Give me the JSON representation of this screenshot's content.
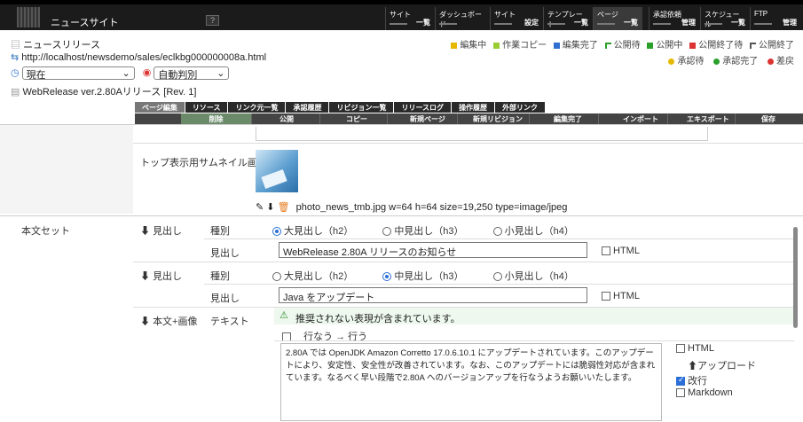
{
  "topbar": {
    "site_name": "ニュースサイト",
    "help": "?",
    "menus": [
      {
        "label": "サイト",
        "sub": "一覧"
      },
      {
        "label": "ダッシュボード",
        "sub": ""
      },
      {
        "label": "サイト",
        "sub": "設定"
      },
      {
        "label": "テンプレート",
        "sub": "一覧"
      },
      {
        "label": "ページ",
        "sub": "一覧"
      },
      {
        "label": "承認依頼",
        "sub": "管理"
      },
      {
        "label": "スケジュール",
        "sub": "一覧"
      },
      {
        "label": "FTP",
        "sub": "管理"
      }
    ]
  },
  "page": {
    "title": "ニュースリリース",
    "url": "http://localhost/newsdemo/sales/eclkbg000000008a.html",
    "version_select": "現在",
    "judge_select": "自動判別",
    "release_title": "WebRelease ver.2.80Aリリース [Rev. 1]"
  },
  "legend1": [
    "編集中",
    "作業コピー",
    "編集完了",
    "公開待",
    "公開中",
    "公開終了待",
    "公開終了"
  ],
  "legend2": [
    "承認待",
    "承認完了",
    "差戻"
  ],
  "tabs": [
    "ページ編集",
    "リソース",
    "リンク元一覧",
    "承認履歴",
    "リビジョン一覧",
    "リリースログ",
    "操作履歴",
    "外部リンク"
  ],
  "toolbar": [
    "削除",
    "公開",
    "コピー",
    "新規ページ",
    "新規リビジョン",
    "編集完了",
    "インポート",
    "エキスポート",
    "保存"
  ],
  "thumbnail": {
    "label": "トップ表示用サムネイル画像",
    "file": "photo_news_tmb.jpg w=64 h=64 size=19,250 type=image/jpeg"
  },
  "body_set": {
    "label": "本文セット",
    "h1": {
      "section": "見出し",
      "kind_label": "種別",
      "options": [
        "大見出し（h2）",
        "中見出し（h3）",
        "小見出し（h4）"
      ],
      "heading_label": "見出し",
      "value": "WebRelease 2.80A リリースのお知らせ",
      "html": "HTML"
    },
    "h2": {
      "section": "見出し",
      "kind_label": "種別",
      "options": [
        "大見出し（h2）",
        "中見出し（h3）",
        "小見出し（h4）"
      ],
      "heading_label": "見出し",
      "value": "Java をアップデート",
      "html": "HTML"
    },
    "text_image": {
      "section": "本文+画像",
      "text_label": "テキスト",
      "warning": "推奨されない表現が含まれています。",
      "suggest": "行なう → 行う",
      "text": "2.80A では OpenJDK Amazon Corretto 17.0.6.10.1 にアップデートされています。このアップデートにより、安定性、安全性が改善されています。なお、このアップデートには脆弱性対応が含まれています。なるべく早い段階で2.80A へのバージョンアップを行なうようお願いいたします。",
      "html": "HTML",
      "upload": "アップロード",
      "newline": "改行",
      "markdown": "Markdown"
    }
  }
}
